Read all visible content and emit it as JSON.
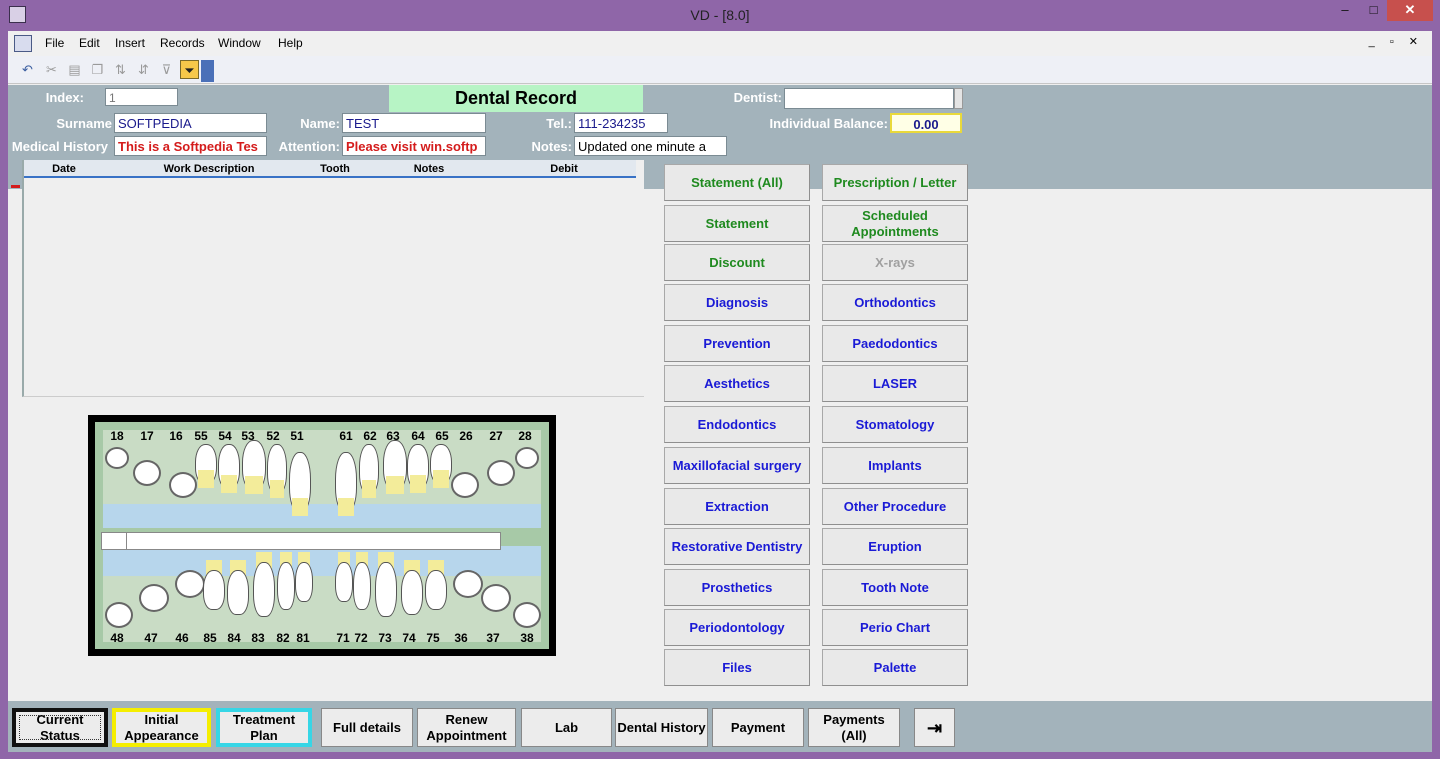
{
  "window": {
    "title": "VD - [8.0]",
    "min": "–",
    "max": "□",
    "close": "✕"
  },
  "menu": [
    "File",
    "Edit",
    "Insert",
    "Records",
    "Window",
    "Help"
  ],
  "mdi_controls": "_ ▫ ✕",
  "header": {
    "record_title": "Dental Record",
    "index_label": "Index:",
    "index_value": "1",
    "dentist_label": "Dentist:",
    "dentist_value": "",
    "surname_label": "Surname",
    "surname_value": "SOFTPEDIA",
    "name_label": "Name:",
    "name_value": "TEST",
    "tel_label": "Tel.:",
    "tel_value": "111-234235",
    "balance_label": "Individual Balance:",
    "balance_value": "0.00",
    "medical_history_label": "Medical History",
    "medical_history_value": "This is a Softpedia Tes",
    "attention_label": "Attention:",
    "attention_value": "Please visit win.softp",
    "notes_label": "Notes:",
    "notes_value": "Updated one minute a"
  },
  "grid": {
    "columns": [
      "Date",
      "Work Description",
      "Tooth",
      "Notes",
      "Debit"
    ]
  },
  "chart": {
    "upper_numbers": [
      "18",
      "17",
      "16",
      "55",
      "54",
      "53",
      "52",
      "51",
      "61",
      "62",
      "63",
      "64",
      "65",
      "26",
      "27",
      "28"
    ],
    "lower_numbers": [
      "48",
      "47",
      "46",
      "85",
      "84",
      "83",
      "82",
      "81",
      "71",
      "72",
      "73",
      "74",
      "75",
      "36",
      "37",
      "38"
    ]
  },
  "buttons_left": [
    "Statement (All)",
    "Statement",
    "Discount",
    "Diagnosis",
    "Prevention",
    "Aesthetics",
    "Endodontics",
    "Maxillofacial surgery",
    "Extraction",
    "Restorative Dentistry",
    "Prosthetics",
    "Periodontology",
    "Files"
  ],
  "buttons_right": [
    "Prescription / Letter",
    "Scheduled Appointments",
    "X-rays",
    "Orthodontics",
    "Paedodontics",
    "LASER",
    "Stomatology",
    "Implants",
    "Other Procedure",
    "Eruption",
    "Tooth Note",
    "Perio Chart",
    "Palette"
  ],
  "footer": [
    "Current Status",
    "Initial Appearance",
    "Treatment Plan",
    "Full details",
    "Renew Appointment",
    "Lab",
    "Dental History",
    "Payment",
    "Payments (All)"
  ],
  "colors": {
    "title_bar": "#8f66a8",
    "header_bg": "#a3b3bb",
    "record_title_bg": "#b7f4c5",
    "green_text": "#1f8a1f",
    "blue_text": "#1a1ad6",
    "red_text": "#d41c1c"
  }
}
